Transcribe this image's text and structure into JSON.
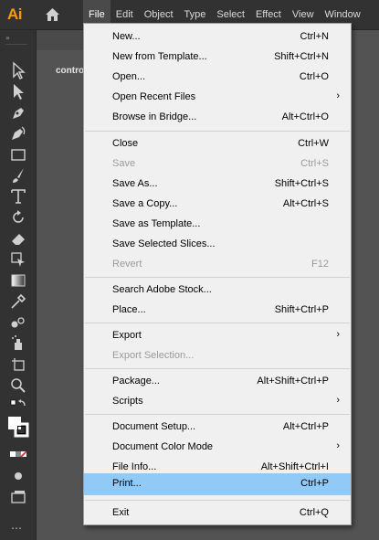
{
  "app": {
    "logo": "Ai"
  },
  "menubar": {
    "items": [
      "File",
      "Edit",
      "Object",
      "Type",
      "Select",
      "Effect",
      "View",
      "Window"
    ]
  },
  "document": {
    "tab_label": "contro"
  },
  "toolbar": {
    "grip": "»",
    "more_label": "…"
  },
  "file_menu": {
    "items": [
      {
        "label": "New...",
        "shortcut": "Ctrl+N"
      },
      {
        "label": "New from Template...",
        "shortcut": "Shift+Ctrl+N"
      },
      {
        "label": "Open...",
        "shortcut": "Ctrl+O"
      },
      {
        "label": "Open Recent Files",
        "submenu": "›"
      },
      {
        "label": "Browse in Bridge...",
        "shortcut": "Alt+Ctrl+O"
      },
      {
        "label": "Close",
        "shortcut": "Ctrl+W"
      },
      {
        "label": "Save",
        "shortcut": "Ctrl+S"
      },
      {
        "label": "Save As...",
        "shortcut": "Shift+Ctrl+S"
      },
      {
        "label": "Save a Copy...",
        "shortcut": "Alt+Ctrl+S"
      },
      {
        "label": "Save as Template..."
      },
      {
        "label": "Save Selected Slices..."
      },
      {
        "label": "Revert",
        "shortcut": "F12"
      },
      {
        "label": "Search Adobe Stock..."
      },
      {
        "label": "Place...",
        "shortcut": "Shift+Ctrl+P"
      },
      {
        "label": "Export",
        "submenu": "›"
      },
      {
        "label": "Export Selection..."
      },
      {
        "label": "Package...",
        "shortcut": "Alt+Shift+Ctrl+P"
      },
      {
        "label": "Scripts",
        "submenu": "›"
      },
      {
        "label": "Document Setup...",
        "shortcut": "Alt+Ctrl+P"
      },
      {
        "label": "Document Color Mode",
        "submenu": "›"
      },
      {
        "label": "File Info...",
        "shortcut": "Alt+Shift+Ctrl+I"
      },
      {
        "label": "Print...",
        "shortcut": "Ctrl+P"
      },
      {
        "label": "Exit",
        "shortcut": "Ctrl+Q"
      }
    ]
  },
  "colors": {
    "highlight": "#91c9f7",
    "accent": "#ff9a00",
    "disabled": "#9a9a9a"
  }
}
